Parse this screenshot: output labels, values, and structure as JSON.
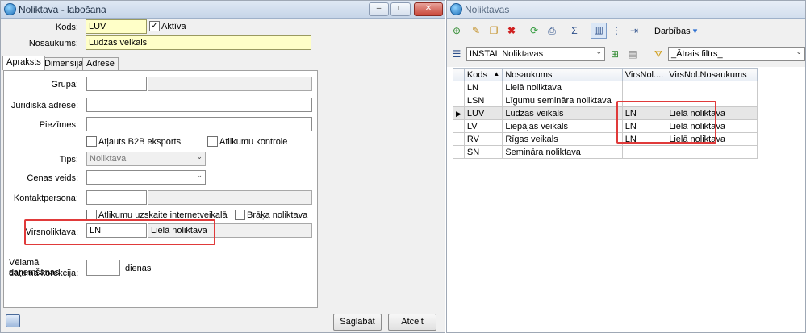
{
  "left_window": {
    "title": "Noliktava - labošana",
    "fields": {
      "kods_label": "Kods:",
      "kods_value": "LUV",
      "aktiva_label": "Aktīva",
      "aktiva_checked": true,
      "nosaukums_label": "Nosaukums:",
      "nosaukums_value": "Ludzas veikals"
    },
    "tabs": [
      "Apraksts",
      "Dimensijas",
      "Adrese"
    ],
    "panel": {
      "grupa_label": "Grupa:",
      "juridiska_label": "Juridiskā adrese:",
      "piezimes_label": "Piezīmes:",
      "b2b_label": "Atļauts B2B eksports",
      "atlikumu_kontrole_label": "Atlikumu kontrole",
      "tips_label": "Tips:",
      "tips_value": "Noliktava",
      "cenas_label": "Cenas veids:",
      "kontakt_label": "Kontaktpersona:",
      "uzskaite_label": "Atlikumu uzskaite internetveikalā",
      "braka_label": "Brāķa noliktava",
      "virs_label": "Virsnoliktava:",
      "virs_code": "LN",
      "virs_name": "Lielā noliktava",
      "velama_label_1": "Vēlamā saņemšanas",
      "velama_label_2": "datuma korekcija:",
      "dienas_label": "dienas"
    },
    "buttons": {
      "save": "Saglabāt",
      "cancel": "Atcelt"
    }
  },
  "right_window": {
    "title": "Noliktavas",
    "toolbar": {
      "actions_label": "Darbības"
    },
    "filters": {
      "layout_value": "INSTAL Noliktavas",
      "quick_filter": "_Ātrais filtrs_"
    },
    "grid": {
      "columns": [
        "Kods",
        "Nosaukums",
        "VirsNol....",
        "VirsNol.Nosaukums"
      ],
      "rows": [
        [
          "LN",
          "Lielā noliktava",
          "",
          ""
        ],
        [
          "LSN",
          "Līgumu semināra noliktava",
          "",
          ""
        ],
        [
          "LUV",
          "Ludzas veikals",
          "LN",
          "Lielā noliktava"
        ],
        [
          "LV",
          "Liepājas veikals",
          "LN",
          "Lielā noliktava"
        ],
        [
          "RV",
          "Rīgas veikals",
          "LN",
          "Lielā noliktava"
        ],
        [
          "SN",
          "Semināra noliktava",
          "",
          ""
        ]
      ],
      "selected_row": 2
    }
  },
  "colors": {
    "highlight_red": "#e03a3a",
    "yellow_field": "#ffffc8"
  }
}
